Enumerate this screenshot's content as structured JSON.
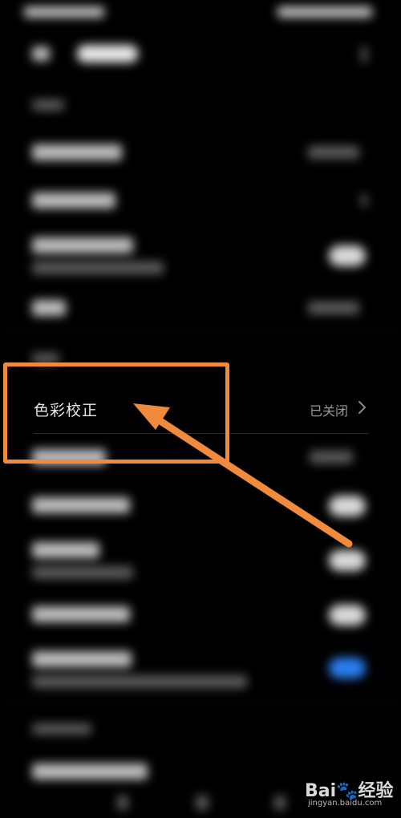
{
  "settings": {
    "color_correction": {
      "label": "色彩校正",
      "value": "已关闭"
    }
  },
  "annotation": {
    "box_color": "#f08a3c",
    "arrow_color": "#f08a3c"
  },
  "watermark": {
    "logo": "Bai🐾经验",
    "url": "jingyan.baidu.com"
  }
}
